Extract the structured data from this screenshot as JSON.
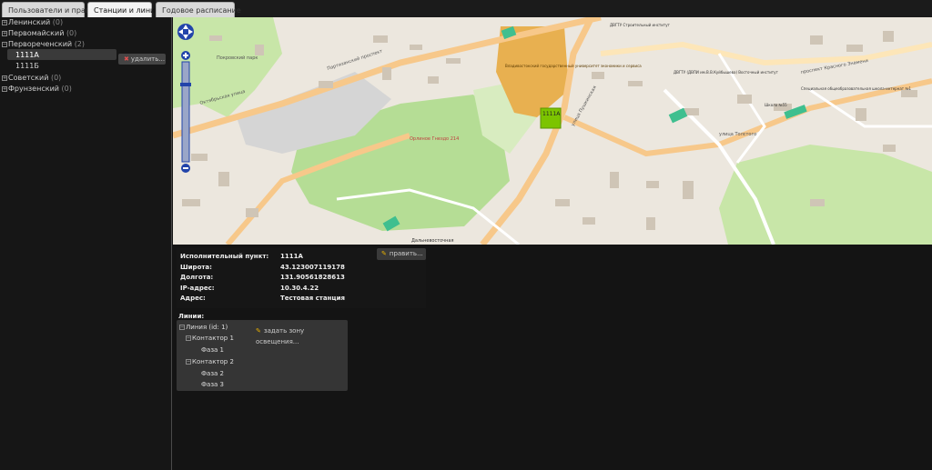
{
  "tabs": [
    {
      "label": "Пользователи и права",
      "active": false
    },
    {
      "label": "Станции и линии",
      "active": true
    },
    {
      "label": "Годовое расписание",
      "active": false
    }
  ],
  "districts": [
    {
      "name": "Ленинский",
      "count": "(0)"
    },
    {
      "name": "Первомайский",
      "count": "(0)"
    },
    {
      "name": "Первореченский",
      "count": "(2)"
    },
    {
      "name": "Советский",
      "count": "(0)"
    },
    {
      "name": "Фрунзенский",
      "count": "(0)"
    }
  ],
  "stations": [
    "1111А",
    "1111Б"
  ],
  "delete_label": "удалить...",
  "map": {
    "marker_label": "1111А",
    "labels": {
      "park": "Покровский парк",
      "university": "Владивостокский государственный университет экономики и сервиса",
      "peak": "Орлиное Гнездо 214",
      "street1": "Октябрьская улица",
      "street2": "Партизанский проспект",
      "street3": "проспект Красного Знамени",
      "street4": "улица Пушкинская",
      "street5": "улица Толстого",
      "street6": "Дальневосточная",
      "build1": "ДВГТУ Строительный институт",
      "build2": "ДВГТУ (ДВПИ им.В.В.Куйбышева) Восточный институт",
      "build3": "Специальная общеобразовательная школа-интернат №1",
      "school": "Школа №55"
    }
  },
  "info": {
    "edit_label": "править...",
    "rows": [
      {
        "label": "Исполнительный пункт:",
        "value": "1111А"
      },
      {
        "label": "Широта:",
        "value": "43.123007119178"
      },
      {
        "label": "Долгота:",
        "value": "131.90561828613"
      },
      {
        "label": "IP-адрес:",
        "value": "10.30.4.22"
      },
      {
        "label": "Адрес:",
        "value": "Тестовая станция"
      }
    ]
  },
  "lines": {
    "title": "Линии:",
    "zone_label": "задать зону освещения...",
    "line": "Линия (id: 1)",
    "contactors": [
      {
        "name": "Контактор 1",
        "phases": [
          "Фаза 1"
        ]
      },
      {
        "name": "Контактор 2",
        "phases": [
          "Фаза 2",
          "Фаза 3"
        ]
      }
    ]
  },
  "colors": {
    "marker": "#7cc400",
    "park": "#c8e6a8",
    "road": "#f7c88a",
    "highlight": "#e8b050"
  }
}
